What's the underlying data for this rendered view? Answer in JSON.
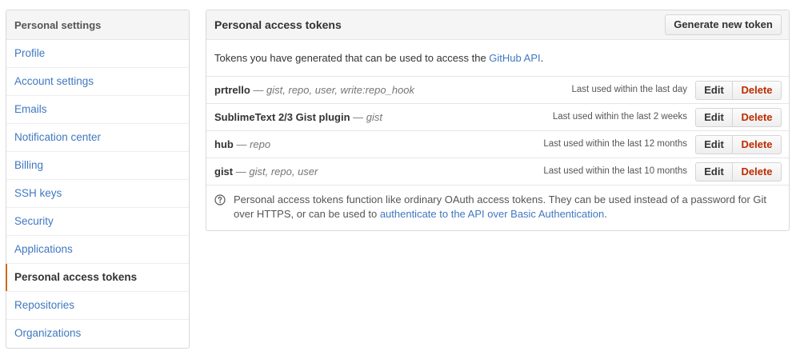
{
  "sidebar": {
    "header": "Personal settings",
    "items": [
      {
        "label": "Profile"
      },
      {
        "label": "Account settings"
      },
      {
        "label": "Emails"
      },
      {
        "label": "Notification center"
      },
      {
        "label": "Billing"
      },
      {
        "label": "SSH keys"
      },
      {
        "label": "Security"
      },
      {
        "label": "Applications"
      },
      {
        "label": "Personal access tokens",
        "selected": true
      },
      {
        "label": "Repositories"
      },
      {
        "label": "Organizations"
      }
    ]
  },
  "panel": {
    "title": "Personal access tokens",
    "generate_label": "Generate new token",
    "intro_text": "Tokens you have generated that can be used to access the ",
    "intro_link": "GitHub API",
    "intro_end": ".",
    "edit_label": "Edit",
    "delete_label": "Delete",
    "separator": "—",
    "tokens": [
      {
        "name": "prtrello",
        "scopes": "gist, repo, user, write:repo_hook",
        "last_used": "Last used within the last day"
      },
      {
        "name": "SublimeText 2/3 Gist plugin",
        "scopes": "gist",
        "last_used": "Last used within the last 2 weeks"
      },
      {
        "name": "hub",
        "scopes": "repo",
        "last_used": "Last used within the last 12 months"
      },
      {
        "name": "gist",
        "scopes": "gist, repo, user",
        "last_used": "Last used within the last 10 months"
      }
    ],
    "note_text": "Personal access tokens function like ordinary OAuth access tokens. They can be used instead of a password for Git over HTTPS, or can be used to ",
    "note_link": "authenticate to the API over Basic Authentication",
    "note_end": "."
  },
  "colors": {
    "link": "#4078c0",
    "selected_marker": "#d26911",
    "delete_text": "#bd2c00"
  }
}
